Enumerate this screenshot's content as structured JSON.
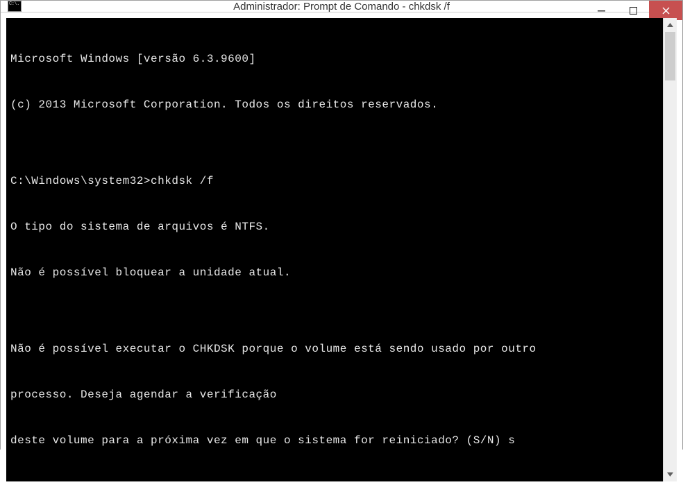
{
  "window": {
    "title": "Administrador: Prompt de Comando - chkdsk  /f",
    "icon_text": "C:\\."
  },
  "terminal": {
    "lines": [
      "Microsoft Windows [versão 6.3.9600]",
      "(c) 2013 Microsoft Corporation. Todos os direitos reservados.",
      "",
      "C:\\Windows\\system32>chkdsk /f",
      "O tipo do sistema de arquivos é NTFS.",
      "Não é possível bloquear a unidade atual.",
      "",
      "Não é possível executar o CHKDSK porque o volume está sendo usado por outro",
      "processo. Deseja agendar a verificação",
      "deste volume para a próxima vez em que o sistema for reiniciado? (S/N) s"
    ]
  }
}
